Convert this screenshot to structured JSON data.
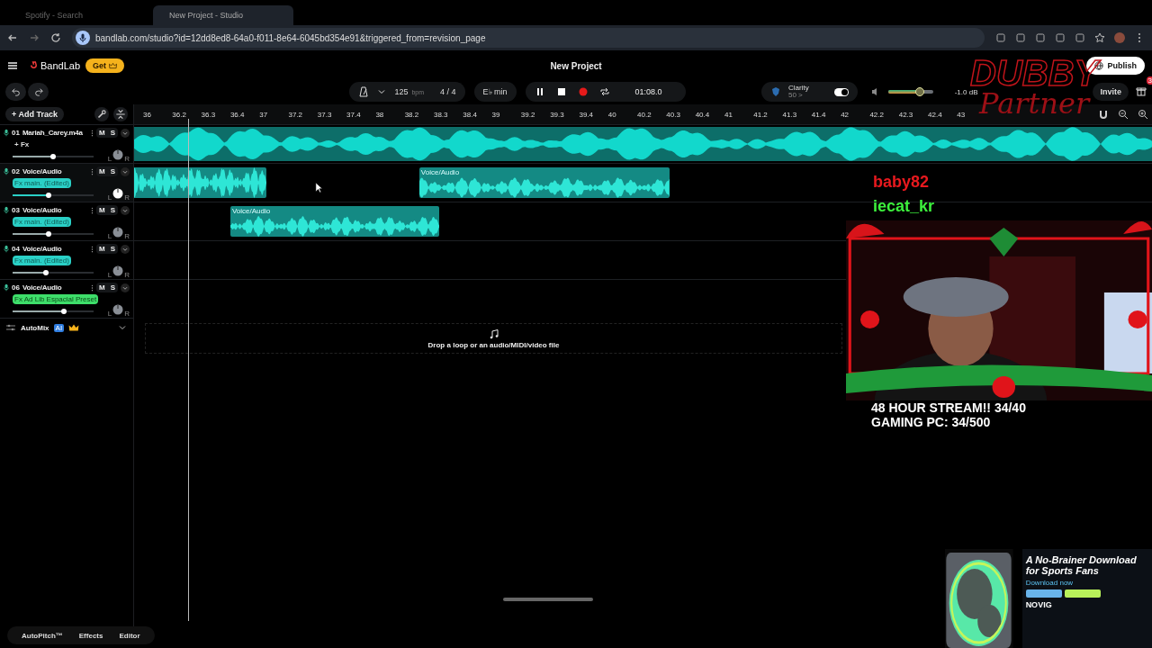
{
  "browser": {
    "tabs": [
      {
        "title": "Spotify - Search",
        "selected": false
      },
      {
        "title": "New Project - Studio",
        "selected": true
      }
    ],
    "url": "bandlab.com/studio?id=12dd8ed8-64a0-f011-8e64-6045bd354e91&triggered_from=revision_page"
  },
  "app": {
    "logo": "BandLab",
    "get_button": "Get",
    "title": "New Project",
    "publish": "Publish",
    "invite": "Invite",
    "notification_count": "3"
  },
  "toolbar": {
    "tempo": "125",
    "tempo_unit": "bpm",
    "time_signature": "4 / 4",
    "key": "E♭ min",
    "time": "01:08.0",
    "clarity": {
      "label": "Clarity",
      "value": "50 >",
      "on": true
    },
    "volume": {
      "level": 0.7,
      "reading": "-1.0 dB"
    }
  },
  "add_track": "+ Add Track",
  "ruler": [
    "36",
    "36.2",
    "36.3",
    "36.4",
    "37",
    "37.2",
    "37.3",
    "37.4",
    "38",
    "38.2",
    "38.3",
    "38.4",
    "39",
    "39.2",
    "39.3",
    "39.4",
    "40",
    "40.2",
    "40.3",
    "40.4",
    "41",
    "41.2",
    "41.3",
    "41.4",
    "42",
    "42.2",
    "42.3",
    "42.4",
    "43"
  ],
  "tracks": [
    {
      "number": "01",
      "name": "Mariah_Carey.m4a",
      "selected": false,
      "mute": "M",
      "solo": "S",
      "pan_left": "L",
      "pan_right": "R",
      "fx": {
        "label": "+ Fx",
        "kind": "add"
      },
      "level": 0.5,
      "clips": [
        {
          "kind": "audio"
        }
      ]
    },
    {
      "number": "02",
      "name": "Voice/Audio",
      "selected": true,
      "mute": "M",
      "solo": "S",
      "pan_left": "L",
      "pan_right": "R",
      "fx": {
        "label": "Fx main. (Edited)",
        "kind": "preset"
      },
      "level": 0.44,
      "clips": [
        {
          "kind": "audio"
        },
        {
          "kind": "audio",
          "label": "Voice/Audio"
        }
      ]
    },
    {
      "number": "03",
      "name": "Voice/Audio",
      "selected": false,
      "mute": "M",
      "solo": "S",
      "pan_left": "L",
      "pan_right": "R",
      "fx": {
        "label": "Fx main. (Edited)",
        "kind": "preset"
      },
      "level": 0.44,
      "clips": [
        {
          "kind": "audio",
          "label": "Voice/Audio"
        }
      ]
    },
    {
      "number": "04",
      "name": "Voice/Audio",
      "selected": false,
      "mute": "M",
      "solo": "S",
      "pan_left": "L",
      "pan_right": "R",
      "fx": {
        "label": "Fx main. (Edited)",
        "kind": "preset"
      },
      "level": 0.41
    },
    {
      "number": "06",
      "name": "Voice/Audio",
      "selected": false,
      "mute": "M",
      "solo": "S",
      "pan_left": "L",
      "pan_right": "R",
      "fx": {
        "label": "Fx Ad Lib Espacial Preset",
        "kind": "custom"
      },
      "level": 0.63
    }
  ],
  "automix": {
    "label": "AutoMix",
    "badge": "AI"
  },
  "drop_hint": "Drop a loop or an audio/MIDI/video file",
  "bottom_bar": [
    "AutoPitch™",
    "Effects",
    "Editor"
  ],
  "stream_overlay": {
    "logo_top": "DUBBY",
    "logo_bottom": "Partner",
    "chat": [
      {
        "user": "baby82",
        "color": "#e8191e"
      },
      {
        "user": "iecat_kr",
        "color": "#3cf03c"
      }
    ],
    "webcam": {
      "kind": "picture"
    },
    "goals": [
      "48 HOUR STREAM!! 34/40",
      "GAMING PC: 34/500"
    ]
  },
  "ad": {
    "headline": "A No-Brainer Download for Sports Fans",
    "cta": "Download now",
    "brand": "NOVIG"
  }
}
